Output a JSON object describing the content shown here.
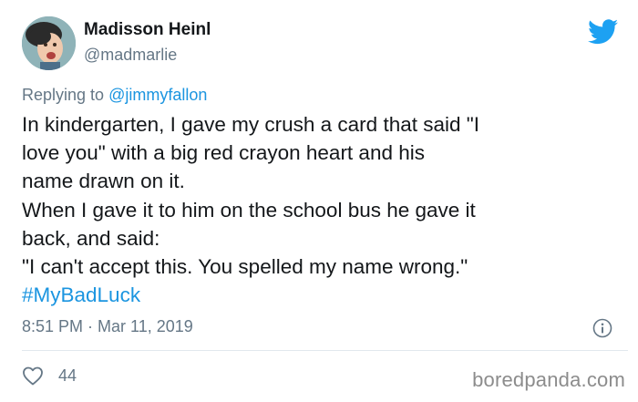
{
  "author": {
    "display_name": "Madisson Heinl",
    "handle": "@madmarlie",
    "avatar_icon": "profile-photo"
  },
  "reply": {
    "prefix": "Replying to ",
    "mention": "@jimmyfallon"
  },
  "tweet": {
    "lines": [
      "In kindergarten, I gave my crush a card that said \"I",
      "love you\" with a big red crayon heart and his",
      "name drawn on it.",
      "When I gave it to him on the school bus he gave it",
      "back, and said:",
      "\"I can't accept this. You spelled my name wrong.\""
    ],
    "hashtag": "#MyBadLuck"
  },
  "meta": {
    "timestamp": "8:51 PM · Mar 11, 2019"
  },
  "actions": {
    "like_count": "44"
  },
  "watermark": "boredpanda.com",
  "icons": {
    "brand": "twitter-bird-icon",
    "info": "info-icon",
    "like": "heart-icon"
  },
  "colors": {
    "link": "#1b95e0",
    "twitter_blue": "#1da1f2",
    "secondary_text": "#657786",
    "primary_text": "#14171a"
  }
}
